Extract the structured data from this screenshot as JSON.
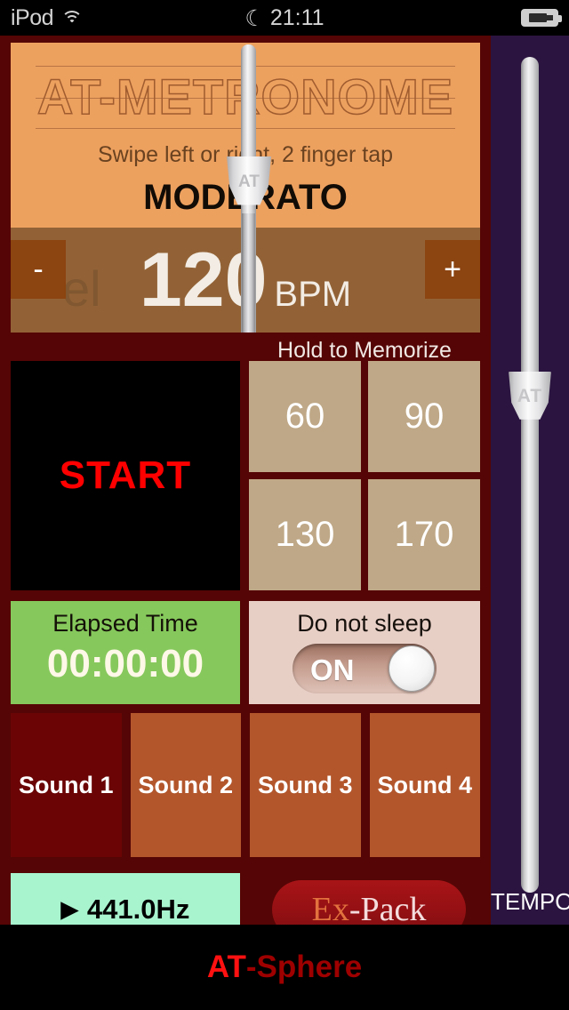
{
  "status_bar": {
    "carrier": "iPod",
    "wifi_icon": "wifi-icon",
    "dnd_icon": "moon-icon",
    "time": "21:11",
    "battery_icon": "battery-charging-icon"
  },
  "header": {
    "brand_title": "AT-METRONOME",
    "hint": "Swipe left or right, 2 finger tap",
    "tempo_name": "MODERATO",
    "ghost_text": "el"
  },
  "bpm": {
    "value": "120",
    "unit": "BPM",
    "minus_label": "-",
    "plus_label": "+"
  },
  "pendulum": {
    "weight_label": "AT"
  },
  "memorize": {
    "label": "Hold to Memorize",
    "presets": [
      {
        "value": "60"
      },
      {
        "value": "90"
      },
      {
        "value": "130"
      },
      {
        "value": "170"
      }
    ]
  },
  "transport": {
    "start_label": "START"
  },
  "elapsed": {
    "label": "Elapsed Time",
    "value": "00:00:00"
  },
  "sleep": {
    "label": "Do not sleep",
    "toggle_state": "ON"
  },
  "sounds": [
    {
      "label": "Sound 1",
      "selected": true
    },
    {
      "label": "Sound 2",
      "selected": false
    },
    {
      "label": "Sound 3",
      "selected": false
    },
    {
      "label": "Sound 4",
      "selected": false
    }
  ],
  "tuner": {
    "play_icon": "play-triangle-icon",
    "frequency": "441.0Hz"
  },
  "expack": {
    "part1": "Ex",
    "part2": "-Pack"
  },
  "tempo_slider": {
    "label": "TEMPO",
    "weight_label": "AT"
  },
  "ad": {
    "brand_bold": "AT",
    "brand_rest": "-Sphere"
  },
  "colors": {
    "app_background": "#550505",
    "header_panel": "#eda15f",
    "bpm_bar": "#926236",
    "bpm_button": "#8c4410",
    "preset_button": "#bfa887",
    "start_background": "#000000",
    "start_text": "#ff0000",
    "elapsed_panel": "#86c85c",
    "sleep_panel": "#e8cfc6",
    "sound_button": "#b3562c",
    "sound_button_selected": "#6b0505",
    "tuner_button": "#a8f4cf",
    "expack_button": "#931013",
    "tempo_column": "#2b1440",
    "ad_brand": "#ff1111"
  }
}
